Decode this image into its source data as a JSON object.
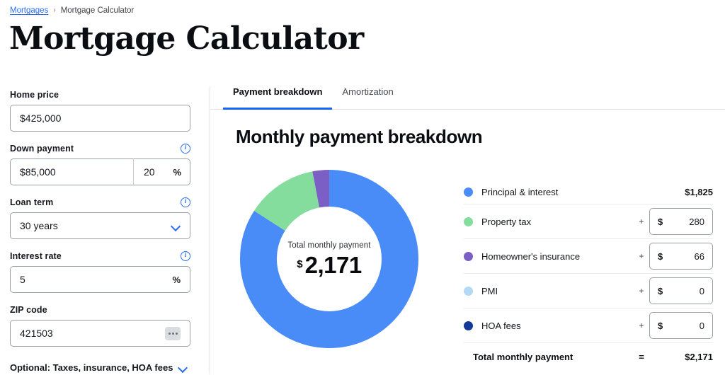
{
  "breadcrumb": {
    "parent": "Mortgages",
    "separator": "›",
    "current": "Mortgage Calculator"
  },
  "page_title": "Mortgage Calculator",
  "form": {
    "home_price": {
      "label": "Home price",
      "value": "$425,000"
    },
    "down_payment": {
      "label": "Down payment",
      "value": "$85,000",
      "percent": "20",
      "percent_symbol": "%"
    },
    "loan_term": {
      "label": "Loan term",
      "value": "30 years"
    },
    "interest_rate": {
      "label": "Interest rate",
      "value": "5",
      "percent_symbol": "%"
    },
    "zip_code": {
      "label": "ZIP code",
      "value": "421503"
    },
    "optional_toggle": "Optional: Taxes, insurance, HOA fees"
  },
  "tabs": [
    {
      "label": "Payment breakdown",
      "active": true
    },
    {
      "label": "Amortization",
      "active": false
    }
  ],
  "panel_title": "Monthly payment breakdown",
  "donut": {
    "caption": "Total monthly payment",
    "currency": "$",
    "amount": "2,171"
  },
  "legend": [
    {
      "label": "Principal & interest",
      "color": "#4a8cf7",
      "value": "$1,825",
      "editable": false
    },
    {
      "label": "Property tax",
      "color": "#85dd9d",
      "operator": "+",
      "currency": "$",
      "value": "280",
      "editable": true
    },
    {
      "label": "Homeowner's insurance",
      "color": "#7b5fc4",
      "operator": "+",
      "currency": "$",
      "value": "66",
      "editable": true
    },
    {
      "label": "PMI",
      "color": "#b3d9f5",
      "operator": "+",
      "currency": "$",
      "value": "0",
      "editable": true
    },
    {
      "label": "HOA fees",
      "color": "#123a96",
      "operator": "+",
      "currency": "$",
      "value": "0",
      "editable": true
    }
  ],
  "total": {
    "label": "Total monthly payment",
    "operator": "=",
    "value": "$2,171"
  },
  "chart_data": {
    "type": "pie",
    "title": "Monthly payment breakdown",
    "categories": [
      "Principal & interest",
      "Property tax",
      "Homeowner's insurance",
      "PMI",
      "HOA fees"
    ],
    "values": [
      1825,
      280,
      66,
      0,
      0
    ],
    "colors": [
      "#4a8cf7",
      "#85dd9d",
      "#7b5fc4",
      "#b3d9f5",
      "#123a96"
    ],
    "total": 2171,
    "unit": "USD per month",
    "legend": "right",
    "donut": true,
    "center_label": "Total monthly payment",
    "center_value": "$ 2,171"
  }
}
